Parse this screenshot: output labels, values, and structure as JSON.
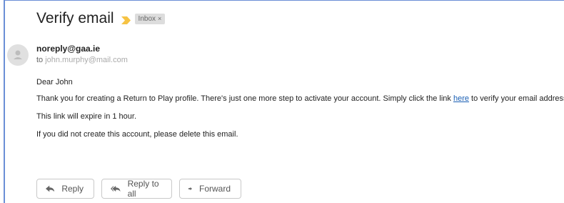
{
  "email": {
    "subject": "Verify email",
    "label": "Inbox",
    "label_close": "×",
    "sender": "noreply@gaa.ie",
    "to_prefix": "to",
    "to_address": "john.murphy@mail.com",
    "greeting": "Dear John",
    "body_before_link": "Thank you for creating a Return to Play profile. There's just one more step to activate your account. Simply click the link ",
    "link_text": "here",
    "body_after_link": " to verify your email address.",
    "expiry": "This link will expire in 1 hour.",
    "disclaimer": "If you did not create this account, please delete this email."
  },
  "actions": {
    "reply": "Reply",
    "reply_all": "Reply to all",
    "forward": "Forward"
  },
  "colors": {
    "importance": "#f6c344",
    "link": "#1a5fb4",
    "frame": "#6b8fd6"
  },
  "icons": {
    "importance": "importance-marker-icon",
    "avatar": "person-icon",
    "reply": "reply-arrow-icon",
    "reply_all": "reply-all-arrow-icon",
    "forward": "forward-arrow-icon"
  }
}
